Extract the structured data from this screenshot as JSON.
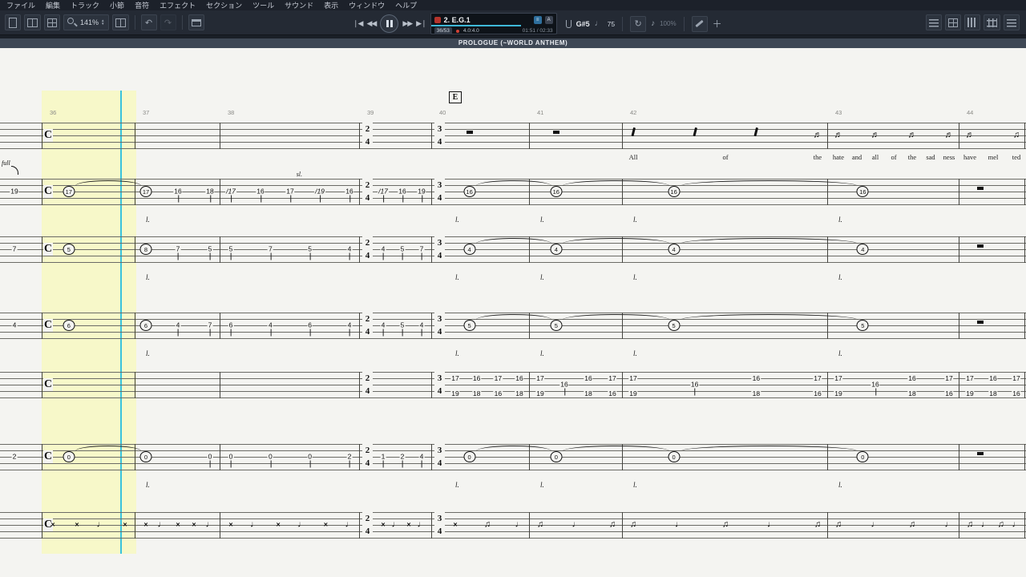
{
  "menubar": {
    "items": [
      "ファイル",
      "編集",
      "トラック",
      "小節",
      "音符",
      "エフェクト",
      "セクション",
      "ツール",
      "サウンド",
      "表示",
      "ウィンドウ",
      "ヘルプ"
    ]
  },
  "toolbar": {
    "zoom_value": "141%"
  },
  "transport": {
    "track_name": "2. E.G.1",
    "position": "36/53",
    "beat": "4.0:4.0",
    "time": "01:51 / 02:33",
    "tuning": "G#5",
    "tempo": "75",
    "speed": "100%"
  },
  "section_bar": {
    "title": "PROLOGUE (~WORLD ANTHEM)"
  },
  "score": {
    "section_letter": "E",
    "clef": "C",
    "measure_numbers": [
      "36",
      "37",
      "38",
      "39",
      "40",
      "41",
      "42",
      "43",
      "44"
    ],
    "time_signatures": [
      {
        "measure": 3,
        "top": "2",
        "bottom": "4"
      },
      {
        "measure": 4,
        "top": "3",
        "bottom": "4"
      }
    ],
    "staves": [
      {
        "id": "vocal",
        "margin_note": "",
        "measures": [
          [],
          [],
          [],
          [],
          [
            "R"
          ],
          [
            "R"
          ],
          [
            "r",
            "r",
            "r",
            "b"
          ],
          [
            "b",
            "b",
            "b",
            "b"
          ],
          [
            "b",
            "m"
          ]
        ],
        "lyrics": [
          "",
          "",
          "",
          "",
          "",
          "",
          "All of the",
          "hate and all of the sad ness",
          "have mel ted"
        ]
      },
      {
        "id": "eg1",
        "margin_note": "19",
        "bend_label": "full",
        "annotation": {
          "measure": 2,
          "text": "sl."
        },
        "measures": [
          [
            "c:17"
          ],
          [
            "c:17",
            "16",
            "18"
          ],
          [
            "s:17",
            "16",
            "17",
            "s:19",
            "16"
          ],
          [
            "s:17",
            "16",
            "19"
          ],
          [
            "c:16"
          ],
          [
            "c:16"
          ],
          [
            "c:16"
          ],
          [
            "c:16"
          ],
          [
            "R"
          ]
        ],
        "letring": [
          1,
          4,
          5,
          6,
          7
        ],
        "ties": [
          [
            0,
            1
          ],
          [
            4,
            5
          ],
          [
            5,
            6
          ],
          [
            6,
            7
          ]
        ]
      },
      {
        "id": "eg2",
        "margin_note": "7",
        "measures": [
          [
            "c:5"
          ],
          [
            "c:8",
            "7",
            "5"
          ],
          [
            "5",
            "7",
            "5",
            "4"
          ],
          [
            "4",
            "5",
            "7"
          ],
          [
            "c:4"
          ],
          [
            "c:4"
          ],
          [
            "c:4"
          ],
          [
            "c:4"
          ],
          [
            "R"
          ]
        ],
        "letring": [
          1,
          4,
          5,
          6,
          7
        ],
        "ties": [
          [
            4,
            5
          ],
          [
            5,
            6
          ],
          [
            6,
            7
          ]
        ]
      },
      {
        "id": "eg3",
        "margin_note": "4",
        "measures": [
          [
            "c:6"
          ],
          [
            "c:6",
            "4",
            "7"
          ],
          [
            "6",
            "4",
            "6",
            "4"
          ],
          [
            "4",
            "5",
            "4"
          ],
          [
            "c:5"
          ],
          [
            "c:5"
          ],
          [
            "c:5"
          ],
          [
            "c:5"
          ],
          [
            "R"
          ]
        ],
        "letring": [
          1,
          4,
          5,
          6,
          7
        ],
        "ties": [
          [
            4,
            5
          ],
          [
            5,
            6
          ],
          [
            6,
            7
          ]
        ]
      },
      {
        "id": "eg4",
        "margin_note": "",
        "measures": [
          [],
          [],
          [],
          [],
          [
            "p:17/19",
            "p:16/18",
            "p:17/16",
            "p:16/18"
          ],
          [
            "p:17/19",
            "16",
            "p:16/18",
            "p:17/16"
          ],
          [
            "p:17/19",
            "16",
            "p:16/18",
            "p:17/16"
          ],
          [
            "p:17/19",
            "16",
            "p:16/18",
            "p:17/16"
          ],
          [
            "p:17/19",
            "p:16/18",
            "p:17/16"
          ]
        ]
      },
      {
        "id": "bass",
        "margin_note": "2",
        "measures": [
          [
            "c:0"
          ],
          [
            "c:0",
            "0"
          ],
          [
            "0",
            "0",
            "0",
            "2"
          ],
          [
            "1",
            "2",
            "4"
          ],
          [
            "c:0"
          ],
          [
            "c:0"
          ],
          [
            "c:0"
          ],
          [
            "c:0"
          ],
          [
            "R"
          ]
        ],
        "letring": [
          1,
          4,
          5,
          6,
          7
        ],
        "ties": [
          [
            0,
            1
          ],
          [
            4,
            5
          ],
          [
            5,
            6
          ],
          [
            6,
            7
          ]
        ]
      },
      {
        "id": "drums",
        "margin_note": "",
        "measures": [
          [
            "x",
            "x",
            "n",
            "x"
          ],
          [
            "x",
            "n",
            "x",
            "x",
            "n"
          ],
          [
            "x",
            "n",
            "x",
            "n",
            "x",
            "n"
          ],
          [
            "x",
            "n",
            "x",
            "n"
          ],
          [
            "x",
            "m",
            "n"
          ],
          [
            "m",
            "n",
            "m"
          ],
          [
            "m",
            "n",
            "m",
            "n",
            "m"
          ],
          [
            "m",
            "n",
            "m",
            "n"
          ],
          [
            "m",
            "n",
            "m",
            "n"
          ]
        ]
      }
    ]
  }
}
